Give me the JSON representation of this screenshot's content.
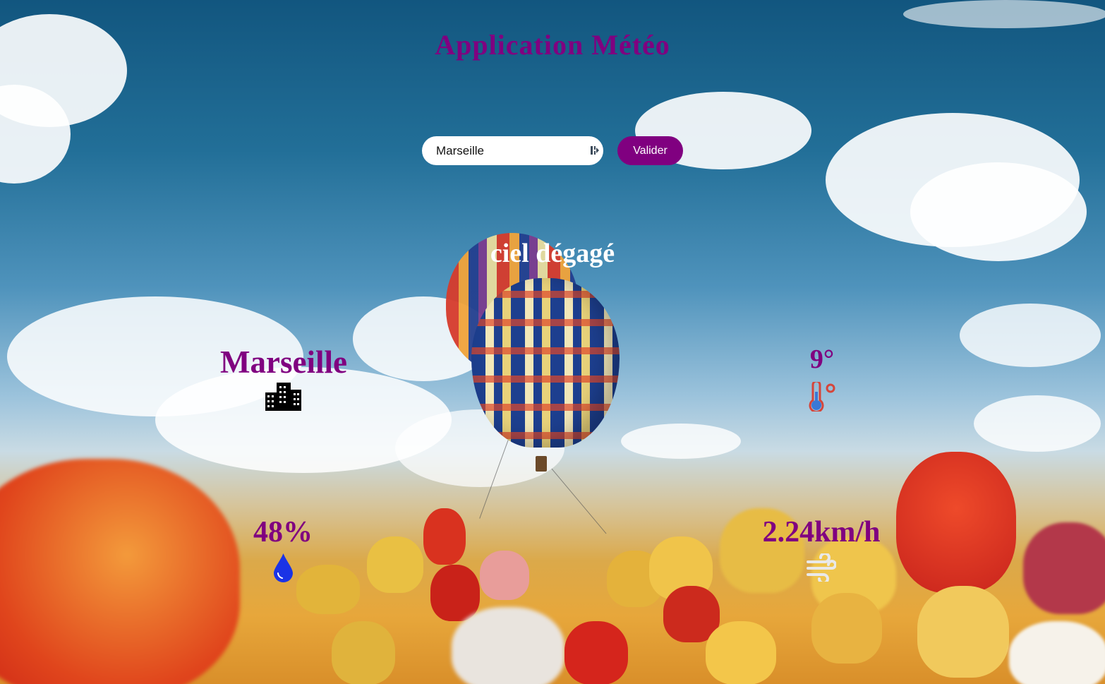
{
  "app": {
    "title": "Application Météo"
  },
  "search": {
    "value": "Marseille",
    "button_label": "Valider"
  },
  "weather": {
    "description": "ciel dégagé",
    "city": "Marseille",
    "temperature": "9°",
    "humidity": "48%",
    "wind": "2.24km/h"
  },
  "icons": {
    "city": "city-buildings-icon",
    "temperature": "thermometer-icon",
    "humidity": "water-drop-icon",
    "wind": "wind-icon",
    "input": "password-manager-icon"
  },
  "colors": {
    "accent": "#800080",
    "description": "#ffffff",
    "drop": "#1a33e6"
  }
}
